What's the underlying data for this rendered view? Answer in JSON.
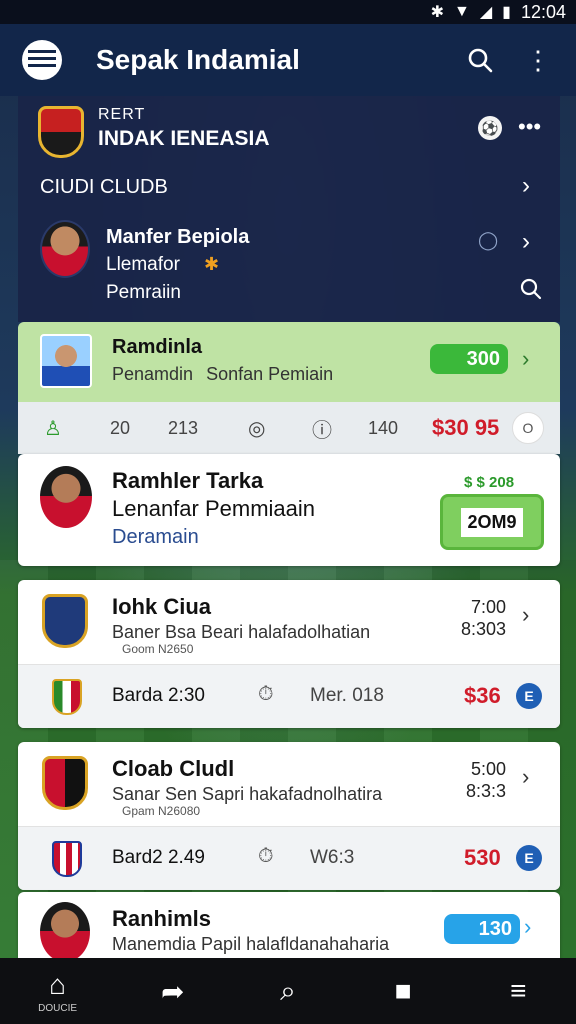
{
  "status_bar": {
    "time": "12:04"
  },
  "app_bar": {
    "title": "Sepak Indamial"
  },
  "club_header": {
    "eyebrow": "RERT",
    "club_name": "INDAK IENEASIA",
    "subheading": "CIUDI CLUDB",
    "manager": {
      "name": "Manfer Bepiola",
      "role": "Llemafor",
      "position": "Pemraiin"
    }
  },
  "featured": {
    "name": "Ramdinla",
    "subtitle": "Penamdin",
    "tag": "Sonfan Pemiain",
    "value": "300"
  },
  "stats_row": {
    "s1": "20",
    "s2": "213",
    "s3": "140",
    "price": "$30 95",
    "circle": "O"
  },
  "player_card": {
    "name": "Ramhler Tarka",
    "role": "Lenanfar Pemmiaain",
    "position": "Deramain",
    "bonus": "$ $ 208",
    "value": "2OM9"
  },
  "match1": {
    "club": "Iohk Ciua",
    "desc": "Baner Bsa Beari halafadolhatian",
    "sub": "Goom N2650",
    "time_top": "7:00",
    "time_bottom": "8:303",
    "row_team": "Barda 2:30",
    "row_mid": "Mer. 018",
    "price": "$36",
    "coin": "E"
  },
  "match2": {
    "club": "Cloab Cludl",
    "desc": "Sanar Sen Sapri hakafadnolhatira",
    "sub": "Gpam N26080",
    "time_top": "5:00",
    "time_bottom": "8:3:3",
    "row_team": "Bard2 2.49",
    "row_mid": "W6:3",
    "price": "530",
    "coin": "E"
  },
  "ranking": {
    "title": "Ranhimls",
    "desc": "Manemdia Papil halafldanahaharia",
    "value": "130"
  },
  "bottom_nav": {
    "home_label": "DOUCIE"
  },
  "colors": {
    "appbar": "#12264a",
    "accent_green": "#3bb83a",
    "price_red": "#d01c2a",
    "accent_blue": "#27a3e8"
  }
}
